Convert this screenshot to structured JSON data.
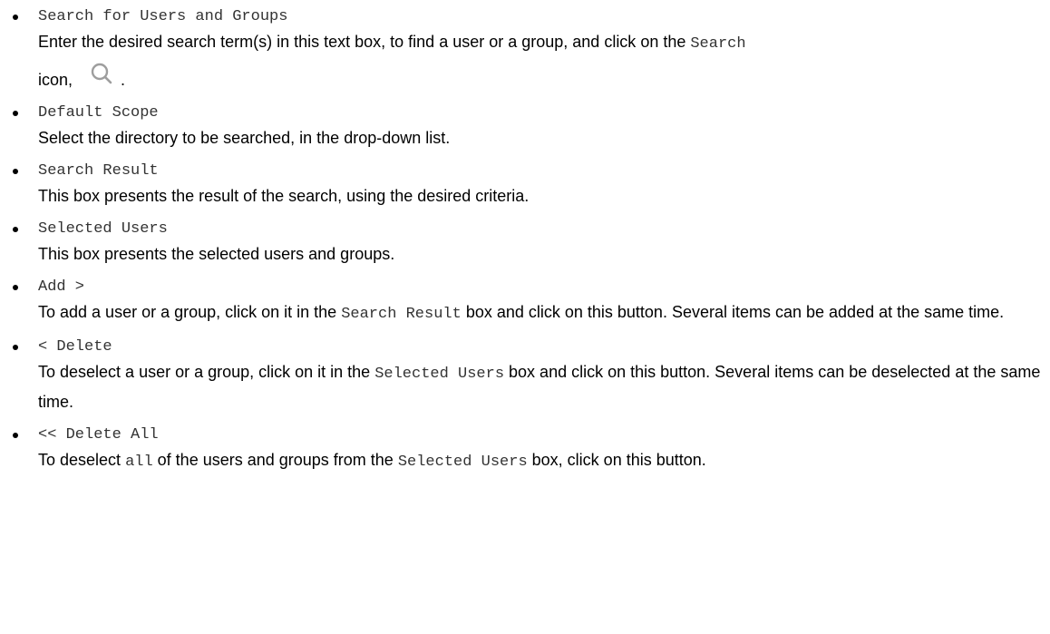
{
  "items": [
    {
      "term": "Search for Users and Groups",
      "desc_part1": "Enter the desired search term(s) in this text box, to find a user or a group, and click on the ",
      "desc_code1": "Search",
      "desc_part2": "icon, ",
      "desc_part3": ".",
      "icon": "search-icon"
    },
    {
      "term": "Default Scope",
      "desc": "Select the directory to be searched, in the drop-down list."
    },
    {
      "term": "Search Result",
      "desc": "This box presents the result of the search, using the desired criteria."
    },
    {
      "term": "Selected Users",
      "desc": "This box presents the selected users and groups."
    },
    {
      "term": "Add >",
      "desc_part1": "To add a user or a group, click on it in the ",
      "desc_code1": "Search Result",
      "desc_part2": " box and click on this button. Several items can be added at the same time."
    },
    {
      "term": "< Delete",
      "desc_part1": "To deselect a user or a group, click on it in the ",
      "desc_code1": "Selected Users",
      "desc_part2": " box and click on this button. Several items can be deselected at the same time."
    },
    {
      "term": "<< Delete All",
      "desc_part1": "To deselect ",
      "desc_code1": "all",
      "desc_part2": " of the users and groups from the ",
      "desc_code2": "Selected Users",
      "desc_part3": " box, click on this button."
    }
  ],
  "colors": {
    "text": "#000000",
    "code": "#333333",
    "icon": "#9e9e9e"
  }
}
